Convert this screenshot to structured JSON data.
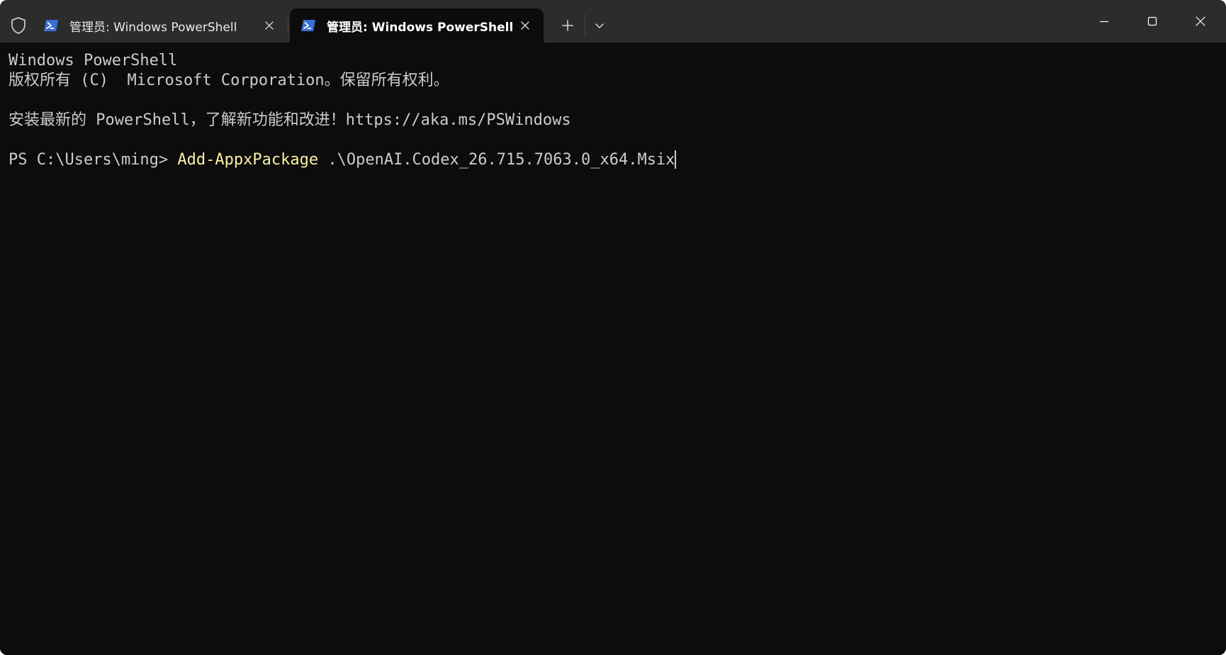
{
  "tabs": [
    {
      "title": "管理员: Windows PowerShell",
      "active": false,
      "icon": "powershell-icon"
    },
    {
      "title": "管理员: Windows PowerShell",
      "active": true,
      "icon": "powershell-icon"
    }
  ],
  "toolbar": {
    "shield_icon": "shield-icon",
    "new_tab_icon": "plus-icon",
    "dropdown_icon": "chevron-down-icon"
  },
  "window_controls": {
    "minimize_icon": "minimize-icon",
    "maximize_icon": "maximize-icon",
    "close_icon": "close-icon"
  },
  "terminal": {
    "lines": [
      "Windows PowerShell",
      "版权所有 (C)  Microsoft Corporation。保留所有权利。",
      "",
      "安装最新的 PowerShell，了解新功能和改进！https://aka.ms/PSWindows",
      ""
    ],
    "prompt": "PS C:\\Users\\ming> ",
    "command": "Add-AppxPackage",
    "argument": " .\\OpenAI.Codex_26.715.7063.0_x64.Msix"
  },
  "colors": {
    "background": "#0c0c0c",
    "tabbar": "#2c2c2c",
    "text": "#cccccc",
    "command": "#f9f1a5",
    "powershell_icon": "#3a6fd8"
  }
}
